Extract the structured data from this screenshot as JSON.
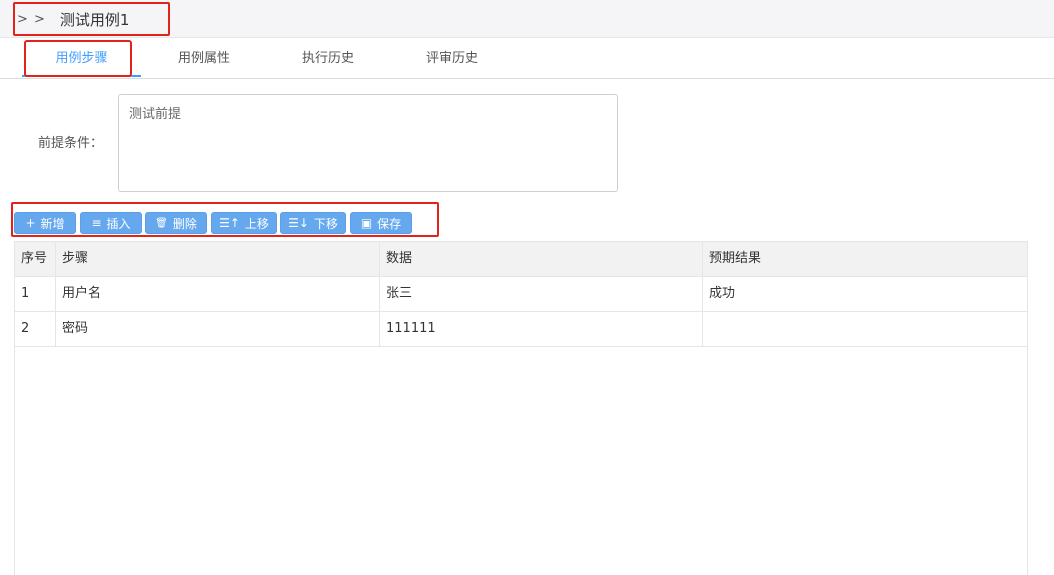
{
  "header": {
    "crumb": "> >",
    "title": "测试用例1"
  },
  "tabs": [
    {
      "label": "用例步骤",
      "active": true
    },
    {
      "label": "用例属性",
      "active": false
    },
    {
      "label": "执行历史",
      "active": false
    },
    {
      "label": "评审历史",
      "active": false
    }
  ],
  "precondition": {
    "label": "前提条件：",
    "value": "测试前提"
  },
  "toolbar": {
    "add": {
      "label": "新增",
      "icon": "+"
    },
    "insert": {
      "label": "插入",
      "icon": "≡"
    },
    "delete": {
      "label": "删除",
      "icon": "🗑"
    },
    "move_up": {
      "label": "上移",
      "icon": "☰↑"
    },
    "move_down": {
      "label": "下移",
      "icon": "☰↓"
    },
    "save": {
      "label": "保存",
      "icon": "▣"
    }
  },
  "table": {
    "columns": [
      "序号",
      "步骤",
      "数据",
      "预期结果"
    ],
    "rows": [
      [
        "1",
        "用户名",
        "张三",
        "成功"
      ],
      [
        "2",
        "密码",
        "111111",
        ""
      ]
    ]
  },
  "colors": {
    "accent": "#409eff",
    "button": "#66a8ee",
    "highlight": "#e2231a"
  }
}
